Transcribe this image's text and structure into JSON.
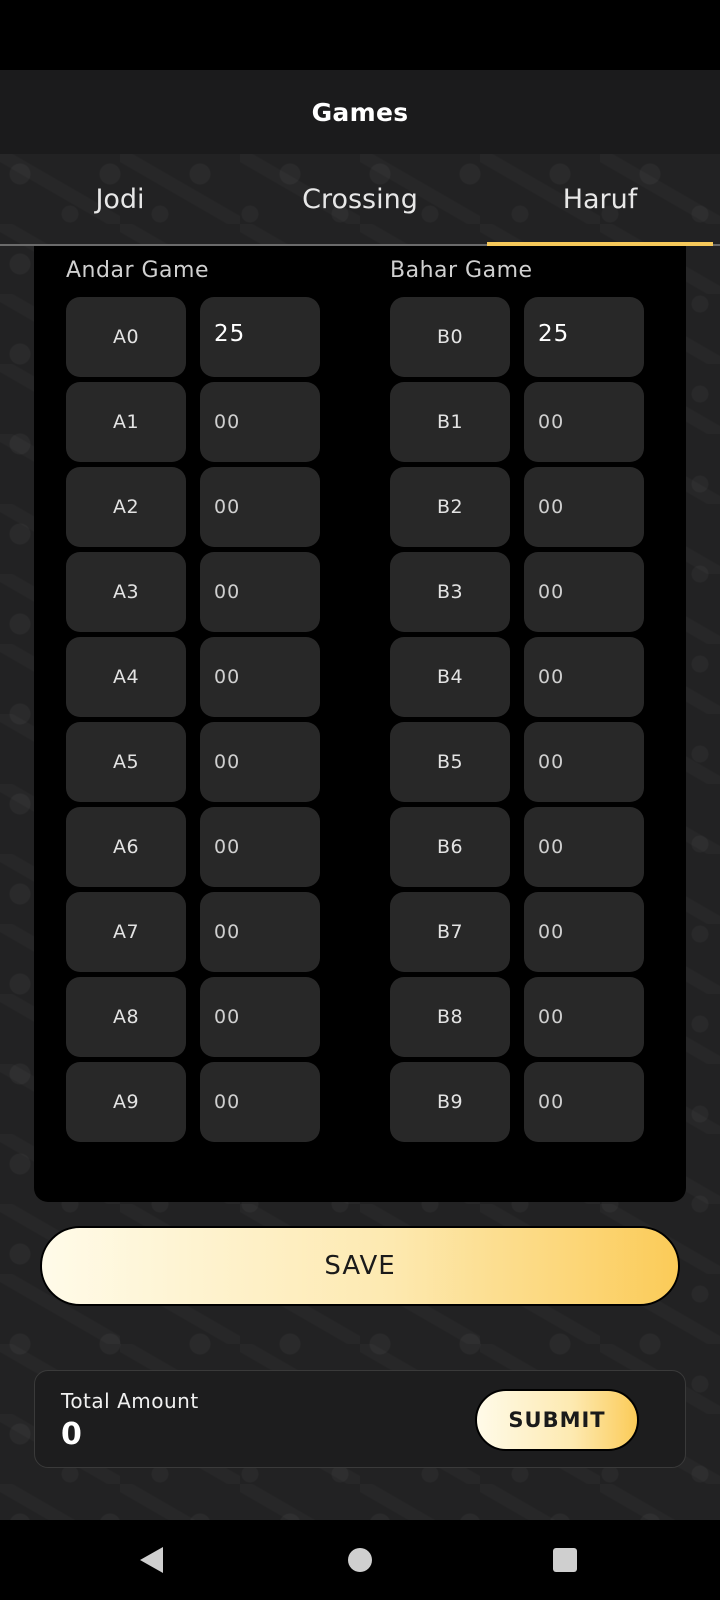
{
  "app_bar": {
    "title": "Games"
  },
  "tabs": [
    {
      "label": "Jodi",
      "active": false
    },
    {
      "label": "Crossing",
      "active": false
    },
    {
      "label": "Haruf",
      "active": true
    }
  ],
  "andar": {
    "heading": "Andar Game",
    "rows": [
      {
        "label": "A0",
        "amount": "25"
      },
      {
        "label": "A1",
        "amount": "00"
      },
      {
        "label": "A2",
        "amount": "00"
      },
      {
        "label": "A3",
        "amount": "00"
      },
      {
        "label": "A4",
        "amount": "00"
      },
      {
        "label": "A5",
        "amount": "00"
      },
      {
        "label": "A6",
        "amount": "00"
      },
      {
        "label": "A7",
        "amount": "00"
      },
      {
        "label": "A8",
        "amount": "00"
      },
      {
        "label": "A9",
        "amount": "00"
      }
    ]
  },
  "bahar": {
    "heading": "Bahar Game",
    "rows": [
      {
        "label": "B0",
        "amount": "25"
      },
      {
        "label": "B1",
        "amount": "00"
      },
      {
        "label": "B2",
        "amount": "00"
      },
      {
        "label": "B3",
        "amount": "00"
      },
      {
        "label": "B4",
        "amount": "00"
      },
      {
        "label": "B5",
        "amount": "00"
      },
      {
        "label": "B6",
        "amount": "00"
      },
      {
        "label": "B7",
        "amount": "00"
      },
      {
        "label": "B8",
        "amount": "00"
      },
      {
        "label": "B9",
        "amount": "00"
      }
    ]
  },
  "save_label": "SAVE",
  "footer": {
    "total_label": "Total Amount",
    "total_value": "0",
    "submit_label": "SUBMIT"
  },
  "nav_bar": {
    "back_icon": "back-triangle-icon",
    "home_icon": "home-circle-icon",
    "recents_icon": "recents-square-icon"
  },
  "colors": {
    "accent": "#f7c95a",
    "button_gradient_start": "#fffbe9",
    "button_gradient_end": "#fbcb58",
    "cell_bg": "#282828"
  }
}
